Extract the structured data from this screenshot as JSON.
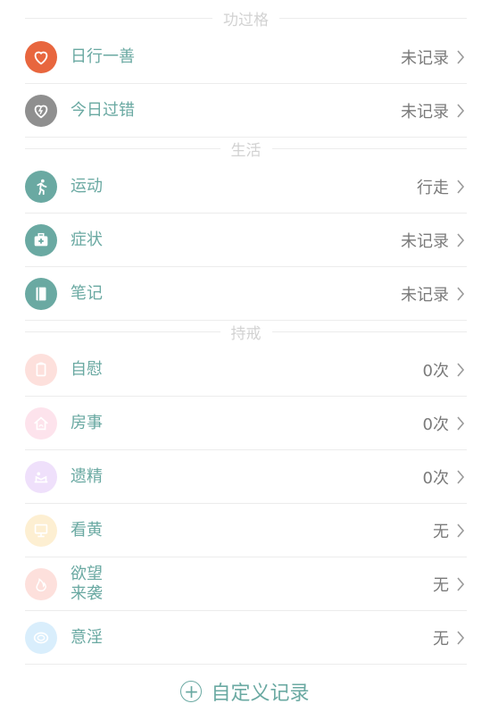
{
  "sections": {
    "merit": "功过格",
    "life": "生活",
    "precepts": "持戒"
  },
  "rows": [
    {
      "label": "日行一善",
      "value": "未记录",
      "icon": "heart-icon",
      "color": "#e8663e"
    },
    {
      "label": "今日过错",
      "value": "未记录",
      "icon": "broken-heart-icon",
      "color": "#8f8f8f"
    },
    {
      "label": "运动",
      "value": "行走",
      "icon": "running-icon",
      "color": "#6aa9a2"
    },
    {
      "label": "症状",
      "value": "未记录",
      "icon": "medical-kit-icon",
      "color": "#6aa9a2"
    },
    {
      "label": "笔记",
      "value": "未记录",
      "icon": "notebook-icon",
      "color": "#6aa9a2"
    },
    {
      "label": "自慰",
      "value": "0次",
      "icon": "tissue-icon",
      "color": "#fde0dc"
    },
    {
      "label": "房事",
      "value": "0次",
      "icon": "house-icon",
      "color": "#fde3ec"
    },
    {
      "label": "遗精",
      "value": "0次",
      "icon": "bed-icon",
      "color": "#efe0fb"
    },
    {
      "label": "看黄",
      "value": "无",
      "icon": "monitor-icon",
      "color": "#fdefd2"
    },
    {
      "label": "欲望\n来袭",
      "value": "无",
      "icon": "flame-icon",
      "color": "#fde0dc"
    },
    {
      "label": "意淫",
      "value": "无",
      "icon": "thought-icon",
      "color": "#d9eefc"
    }
  ],
  "custom_label": "自定义记录"
}
